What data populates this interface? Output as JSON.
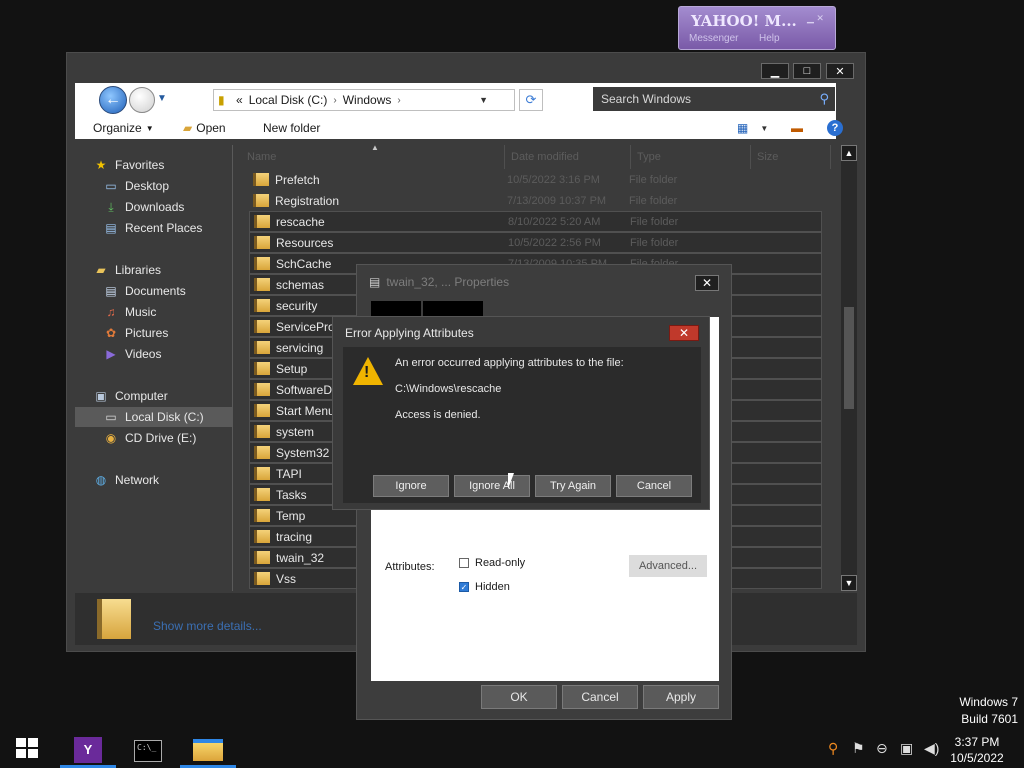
{
  "explorer": {
    "address": {
      "overflow": "«",
      "crumbs": [
        "Local Disk (C:)",
        "Windows"
      ]
    },
    "search_placeholder": "Search Windows",
    "toolbar": {
      "organize": "Organize",
      "open": "Open",
      "new_folder": "New folder"
    },
    "nav": {
      "favorites": "Favorites",
      "desktop": "Desktop",
      "downloads": "Downloads",
      "recent": "Recent Places",
      "libraries": "Libraries",
      "documents": "Documents",
      "music": "Music",
      "pictures": "Pictures",
      "videos": "Videos",
      "computer": "Computer",
      "local_disk": "Local Disk (C:)",
      "cd_drive": "CD Drive (E:)",
      "network": "Network"
    },
    "columns": {
      "name": "Name",
      "date": "Date modified",
      "type": "Type",
      "size": "Size"
    },
    "files": [
      {
        "name": "Prefetch",
        "date": "10/5/2022 3:16 PM",
        "type": "File folder"
      },
      {
        "name": "Registration",
        "date": "7/13/2009 10:37 PM",
        "type": "File folder"
      },
      {
        "name": "rescache",
        "date": "8/10/2022 5:20 AM",
        "type": "File folder"
      },
      {
        "name": "Resources",
        "date": "10/5/2022 2:56 PM",
        "type": "File folder"
      },
      {
        "name": "SchCache",
        "date": "7/13/2009 10:35 PM",
        "type": "File folder"
      },
      {
        "name": "schemas",
        "date": "",
        "type": ""
      },
      {
        "name": "security",
        "date": "",
        "type": ""
      },
      {
        "name": "ServiceProf",
        "date": "",
        "type": ""
      },
      {
        "name": "servicing",
        "date": "",
        "type": ""
      },
      {
        "name": "Setup",
        "date": "",
        "type": ""
      },
      {
        "name": "SoftwareDis",
        "date": "",
        "type": ""
      },
      {
        "name": "Start Menu",
        "date": "",
        "type": ""
      },
      {
        "name": "system",
        "date": "",
        "type": ""
      },
      {
        "name": "System32",
        "date": "",
        "type": ""
      },
      {
        "name": "TAPI",
        "date": "",
        "type": ""
      },
      {
        "name": "Tasks",
        "date": "",
        "type": ""
      },
      {
        "name": "Temp",
        "date": "",
        "type": ""
      },
      {
        "name": "tracing",
        "date": "",
        "type": ""
      },
      {
        "name": "twain_32",
        "date": "",
        "type": ""
      },
      {
        "name": "Vss",
        "date": "",
        "type": ""
      }
    ],
    "details": {
      "show_more": "Show more details..."
    }
  },
  "properties": {
    "title": "twain_32, ... Properties",
    "attributes_label": "Attributes:",
    "readonly": "Read-only",
    "hidden": "Hidden",
    "advanced": "Advanced...",
    "ok": "OK",
    "cancel": "Cancel",
    "apply": "Apply"
  },
  "error": {
    "title": "Error Applying Attributes",
    "line1": "An error occurred applying attributes to the file:",
    "path": "C:\\Windows\\rescache",
    "line3": "Access is denied.",
    "ignore": "Ignore",
    "ignore_all": "Ignore All",
    "try_again": "Try Again",
    "cancel": "Cancel"
  },
  "yahoo": {
    "logo": "YAHOO! M...",
    "messenger": "Messenger",
    "help": "Help"
  },
  "taskbar": {
    "time": "3:37 PM",
    "date": "10/5/2022"
  },
  "watermark": {
    "line1": "Windows 7",
    "line2": "Build 7601"
  }
}
